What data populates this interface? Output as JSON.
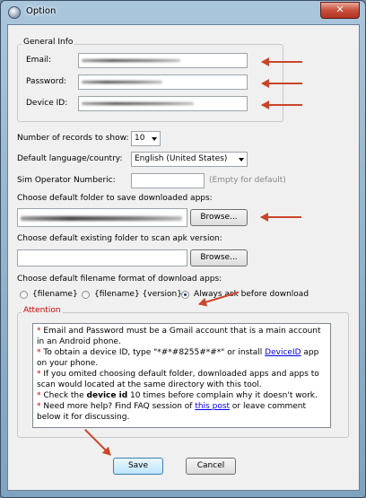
{
  "window": {
    "title": "Option",
    "close": "✕"
  },
  "general": {
    "title": "General Info",
    "email_label": "Email:",
    "password_label": "Password:",
    "device_label": "Device ID:"
  },
  "records": {
    "label": "Number of records  to show:",
    "value": "10"
  },
  "language": {
    "label": "Default language/country:",
    "value": "English (United States)"
  },
  "sim": {
    "label": "Sim Operator Numberic:",
    "hint": "(Empty for default)"
  },
  "download_folder": {
    "label": "Choose default folder to save downloaded apps:",
    "browse": "Browse..."
  },
  "scan_folder": {
    "label": "Choose default existing folder to scan apk version:",
    "browse": "Browse..."
  },
  "filename_format": {
    "label": "Choose default filename format of download apps:",
    "options": [
      "{filename}",
      "{filename} {version}",
      "Always ask before download"
    ],
    "selected": "Always ask before download"
  },
  "attention": {
    "title": "Attention",
    "star": "*",
    "line1": " Email and Password must be a Gmail account that is a main account in an Android phone.",
    "line2a": " To obtain a device ID, type \"*#*#8255#*#*\" or install ",
    "line2_link": "DeviceID",
    "line2b": " app on your phone.",
    "line3": " If you omited choosing default folder, downloaded apps and apps to scan would located at the same directory with this tool.",
    "line4a": " Check the ",
    "line4_bold": "device id",
    "line4b": " 10 times before complain why it doesn't work.",
    "line5a": " Need more help? Find FAQ session of ",
    "line5_link": "this post",
    "line5b": " or leave comment below it for discussing."
  },
  "buttons": {
    "save": "Save",
    "cancel": "Cancel"
  },
  "colors": {
    "annotation_arrow": "#c9462a",
    "star": "#cc0000",
    "link": "#0000ee"
  }
}
